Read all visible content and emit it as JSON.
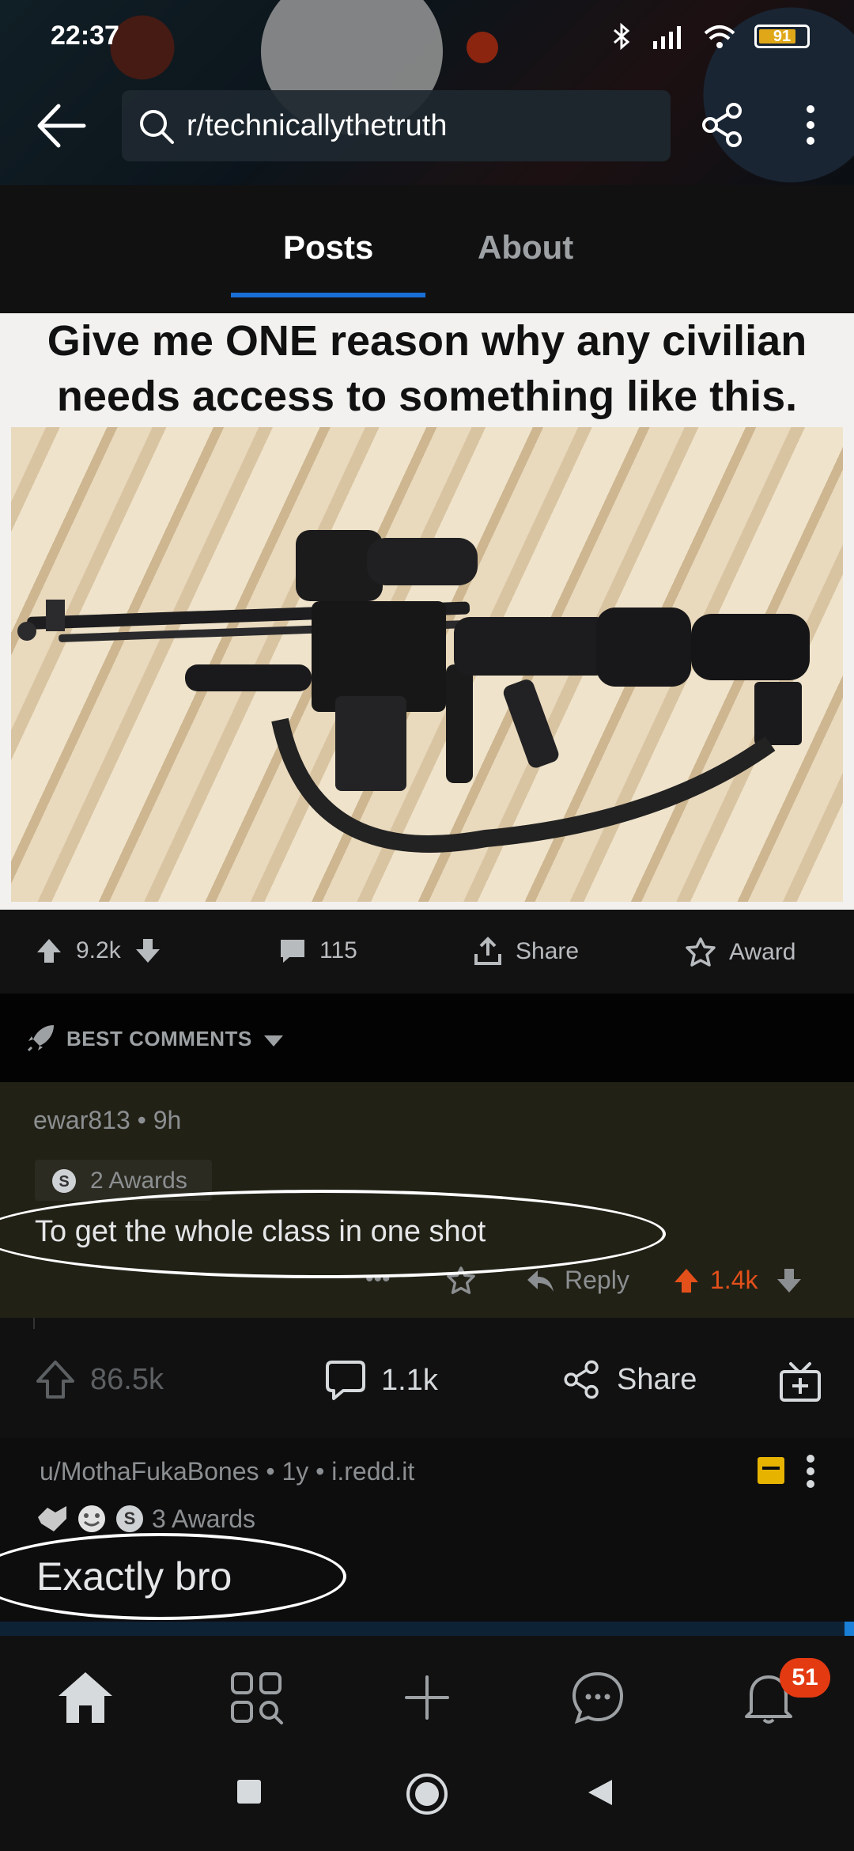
{
  "status_bar": {
    "time": "22:37",
    "battery": "91"
  },
  "search": {
    "query": "r/technicallythetruth"
  },
  "tabs": [
    {
      "label": "Posts",
      "active": true
    },
    {
      "label": "About",
      "active": false
    }
  ],
  "post": {
    "meme_text": "Give me ONE reason why any civilian needs access to something like this.",
    "upvotes": "9.2k",
    "comments": "115",
    "share_label": "Share",
    "award_label": "Award"
  },
  "sort": {
    "label": "BEST COMMENTS"
  },
  "comment": {
    "author_meta": "ewar813 • 9h",
    "awards": "2 Awards",
    "body": "To get the whole class in one shot",
    "reply_label": "Reply",
    "score": "1.4k"
  },
  "post_actions": {
    "upvotes": "86.5k",
    "comments": "1.1k",
    "share_label": "Share"
  },
  "next_post": {
    "meta": "u/MothaFukaBones • 1y • i.redd.it",
    "awards": "3 Awards",
    "title": "Exactly bro"
  },
  "bottom_nav": {
    "notification_count": "51"
  },
  "colors": {
    "accent_blue": "#1a6fd6",
    "upvote_orange": "#e4501a",
    "badge_red": "#e43a12"
  }
}
